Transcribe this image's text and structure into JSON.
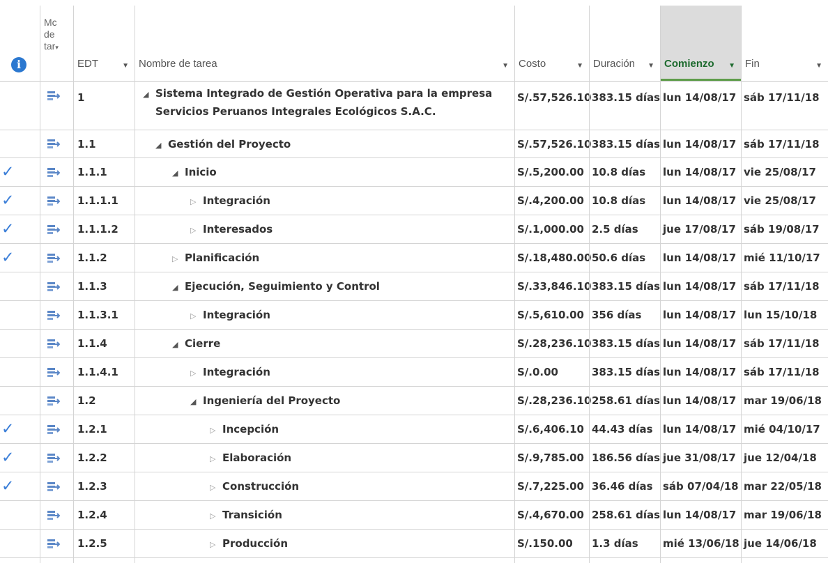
{
  "header": {
    "info_icon": "information-icon",
    "mode_label": "Mc\nde\ntar",
    "columns": {
      "edt": "EDT",
      "name": "Nombre de tarea",
      "cost": "Costo",
      "duration": "Duración",
      "start": "Comienzo",
      "finish": "Fin"
    }
  },
  "rows": [
    {
      "check": "",
      "edt": "1",
      "name_line1": "Sistema Integrado de Gestión Operativa para la empresa",
      "name_line2": "Servicios Peruanos Integrales Ecológicos S.A.C.",
      "indent": 0,
      "tri": "expanded",
      "cost": "S/.57,526.10",
      "duration": "383.15 días",
      "start": "lun 14/08/17",
      "finish": "sáb 17/11/18"
    },
    {
      "check": "",
      "edt": "1.1",
      "name_line1": "Gestión del Proyecto",
      "indent": 1,
      "tri": "expanded",
      "cost": "S/.57,526.10",
      "duration": "383.15 días",
      "start": "lun 14/08/17",
      "finish": "sáb 17/11/18"
    },
    {
      "check": "✓",
      "edt": "1.1.1",
      "name_line1": "Inicio",
      "indent": 2,
      "tri": "expanded",
      "cost": "S/.5,200.00",
      "duration": "10.8 días",
      "start": "lun 14/08/17",
      "finish": "vie 25/08/17"
    },
    {
      "check": "✓",
      "edt": "1.1.1.1",
      "name_line1": "Integración",
      "indent": 3,
      "tri": "collapsed",
      "cost": "S/.4,200.00",
      "duration": "10.8 días",
      "start": "lun 14/08/17",
      "finish": "vie 25/08/17"
    },
    {
      "check": "✓",
      "edt": "1.1.1.2",
      "name_line1": "Interesados",
      "indent": 3,
      "tri": "collapsed",
      "cost": "S/.1,000.00",
      "duration": "2.5 días",
      "start": "jue 17/08/17",
      "finish": "sáb 19/08/17"
    },
    {
      "check": "✓",
      "edt": "1.1.2",
      "name_line1": "Planificación",
      "indent": 2,
      "tri": "collapsed",
      "cost": "S/.18,480.00",
      "duration": "50.6 días",
      "start": "lun 14/08/17",
      "finish": "mié 11/10/17"
    },
    {
      "check": "",
      "edt": "1.1.3",
      "name_line1": "Ejecución, Seguimiento y Control",
      "indent": 2,
      "tri": "expanded",
      "cost": "S/.33,846.10",
      "duration": "383.15 días",
      "start": "lun 14/08/17",
      "finish": "sáb 17/11/18"
    },
    {
      "check": "",
      "edt": "1.1.3.1",
      "name_line1": "Integración",
      "indent": 3,
      "tri": "collapsed",
      "cost": "S/.5,610.00",
      "duration": "356 días",
      "start": "lun 14/08/17",
      "finish": "lun 15/10/18"
    },
    {
      "check": "",
      "edt": "1.1.4",
      "name_line1": "Cierre",
      "indent": 2,
      "tri": "expanded",
      "cost": "S/.28,236.10",
      "duration": "383.15 días",
      "start": "lun 14/08/17",
      "finish": "sáb 17/11/18"
    },
    {
      "check": "",
      "edt": "1.1.4.1",
      "name_line1": "Integración",
      "indent": 3,
      "tri": "collapsed",
      "cost": "S/.0.00",
      "duration": "383.15 días",
      "start": "lun 14/08/17",
      "finish": "sáb 17/11/18"
    },
    {
      "check": "",
      "edt": "1.2",
      "name_line1": "Ingeniería del Proyecto",
      "indent": 3,
      "tri": "expanded",
      "cost": "S/.28,236.10",
      "duration": "258.61 días",
      "start": "lun 14/08/17",
      "finish": "mar 19/06/18"
    },
    {
      "check": "✓",
      "edt": "1.2.1",
      "name_line1": "Incepción",
      "indent": 4,
      "tri": "collapsed",
      "cost": "S/.6,406.10",
      "duration": "44.43 días",
      "start": "lun 14/08/17",
      "finish": "mié 04/10/17"
    },
    {
      "check": "✓",
      "edt": "1.2.2",
      "name_line1": "Elaboración",
      "indent": 4,
      "tri": "collapsed",
      "cost": "S/.9,785.00",
      "duration": "186.56 días",
      "start": "jue 31/08/17",
      "finish": "jue 12/04/18"
    },
    {
      "check": "✓",
      "edt": "1.2.3",
      "name_line1": "Construcción",
      "indent": 4,
      "tri": "collapsed",
      "cost": "S/.7,225.00",
      "duration": "36.46 días",
      "start": "sáb 07/04/18",
      "finish": "mar 22/05/18"
    },
    {
      "check": "",
      "edt": "1.2.4",
      "name_line1": "Transición",
      "indent": 4,
      "tri": "collapsed",
      "cost": "S/.4,670.00",
      "duration": "258.61 días",
      "start": "lun 14/08/17",
      "finish": "mar 19/06/18"
    },
    {
      "check": "",
      "edt": "1.2.5",
      "name_line1": "Producción",
      "indent": 4,
      "tri": "collapsed",
      "cost": "S/.150.00",
      "duration": "1.3 días",
      "start": "mié 13/06/18",
      "finish": "jue 14/06/18"
    }
  ],
  "colors": {
    "checkmark": "#3c7fd8",
    "sorted_header_bg": "#dcdcdc",
    "sorted_header_text": "#1e6b2f",
    "mode_icon": "#5b87c7"
  }
}
